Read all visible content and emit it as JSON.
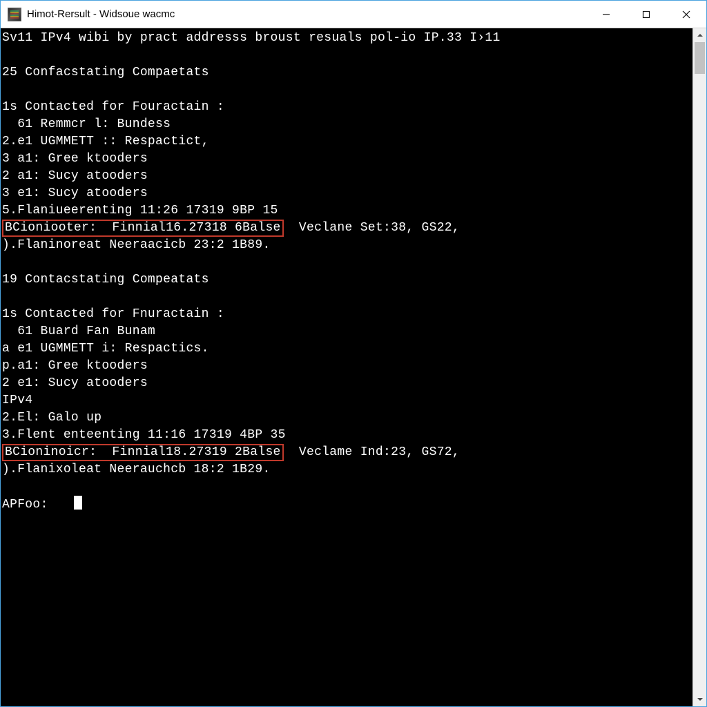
{
  "window": {
    "title": "Himot-Rersult - Widsoue wacmc"
  },
  "terminal": {
    "lines": [
      {
        "pre": "Sv11 IPv4 wibi by pract addresss broust resuals pol-io IP.33 I›11",
        "hl": "",
        "post": ""
      },
      {
        "pre": "",
        "hl": "",
        "post": ""
      },
      {
        "pre": "25 Confacstating Compaetats",
        "hl": "",
        "post": ""
      },
      {
        "pre": "",
        "hl": "",
        "post": ""
      },
      {
        "pre": "1s Contacted for Fouractain :",
        "hl": "",
        "post": ""
      },
      {
        "pre": "  61 Remmcr l: Bundess",
        "hl": "",
        "post": ""
      },
      {
        "pre": "2.e1 UGMMETT :: Respactict,",
        "hl": "",
        "post": ""
      },
      {
        "pre": "3 a1: Gree ktooders",
        "hl": "",
        "post": ""
      },
      {
        "pre": "2 a1: Sucy atooders",
        "hl": "",
        "post": ""
      },
      {
        "pre": "3 e1: Sucy atooders",
        "hl": "",
        "post": ""
      },
      {
        "pre": "5.Flaniueerenting 11:26 17319 9BP 15",
        "hl": "",
        "post": ""
      },
      {
        "pre": "",
        "hl": "BCioniooter:  Finnial16.27318 6Balse",
        "post": "  Veclane Set:38, GS22,"
      },
      {
        "pre": ").Flaninoreat Neeraacicb 23:2 1B89.",
        "hl": "",
        "post": ""
      },
      {
        "pre": "",
        "hl": "",
        "post": ""
      },
      {
        "pre": "19 Contacstating Compeatats",
        "hl": "",
        "post": ""
      },
      {
        "pre": "",
        "hl": "",
        "post": ""
      },
      {
        "pre": "1s Contacted for Fnuractain :",
        "hl": "",
        "post": ""
      },
      {
        "pre": "  61 Buard Fan Bunam",
        "hl": "",
        "post": ""
      },
      {
        "pre": "a e1 UGMMETT i: Respactics.",
        "hl": "",
        "post": ""
      },
      {
        "pre": "p.a1: Gree ktooders",
        "hl": "",
        "post": ""
      },
      {
        "pre": "2 e1: Sucy atooders",
        "hl": "",
        "post": ""
      },
      {
        "pre": "IPv4",
        "hl": "",
        "post": ""
      },
      {
        "pre": "2.El: Galo up",
        "hl": "",
        "post": ""
      },
      {
        "pre": "3.Flent enteenting 11:16 17319 4BP 35",
        "hl": "",
        "post": ""
      },
      {
        "pre": "",
        "hl": "BCioninoicr:  Finnial18.27319 2Balse",
        "post": "  Veclame Ind:23, GS72,"
      },
      {
        "pre": ").Flanixoleat Neerauchcb 18:2 1B29.",
        "hl": "",
        "post": ""
      },
      {
        "pre": "",
        "hl": "",
        "post": ""
      }
    ],
    "prompt": "APFoo:   "
  },
  "colors": {
    "highlight_border": "#c0392b",
    "terminal_bg": "#000000",
    "terminal_fg": "#ffffff",
    "window_border": "#4aa3df"
  }
}
